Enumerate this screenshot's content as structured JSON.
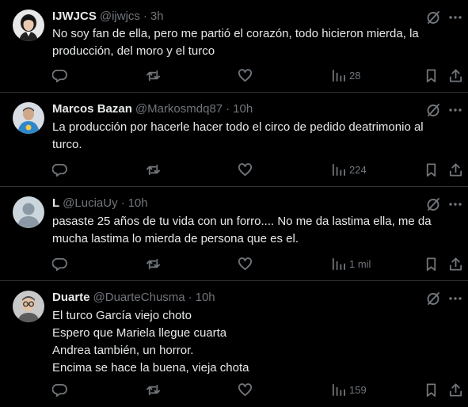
{
  "tweets": [
    {
      "name": "IJWJCS",
      "handle": "@ijwjcs",
      "time": "3h",
      "lines": [
        "No soy fan de ella, pero me partió el corazón, todo hicieron mierda, la",
        "producción, del moro y el turco"
      ],
      "views": "28",
      "avatar": "person-dark-hair-icon"
    },
    {
      "name": "Marcos Bazan",
      "handle": "@Markosmdq87",
      "time": "10h",
      "lines": [
        "La producción por hacerle hacer todo el circo de pedido deatrimonio al",
        "turco."
      ],
      "views": "224",
      "avatar": "person-blue-shirt-icon"
    },
    {
      "name": "L",
      "handle": "@LuciaUy",
      "time": "10h",
      "lines": [
        "pasaste 25 años de tu vida con un forro.... No me da lastima ella, me da",
        "mucha lastima lo mierda de persona que es el."
      ],
      "views": "1 mil",
      "avatar": "default-profile-icon"
    },
    {
      "name": "Duarte",
      "handle": "@DuarteChusma",
      "time": "10h",
      "lines": [
        "El turco García viejo choto",
        "Espero que Mariela llegue cuarta",
        "Andrea también, un horror.",
        "Encima se hace la buena, vieja chota"
      ],
      "views": "159",
      "avatar": "person-glasses-icon"
    }
  ],
  "separator": "·",
  "colors": {
    "background": "#000000",
    "text": "#e7e9ea",
    "muted": "#71767b",
    "divider": "#2f3336"
  }
}
